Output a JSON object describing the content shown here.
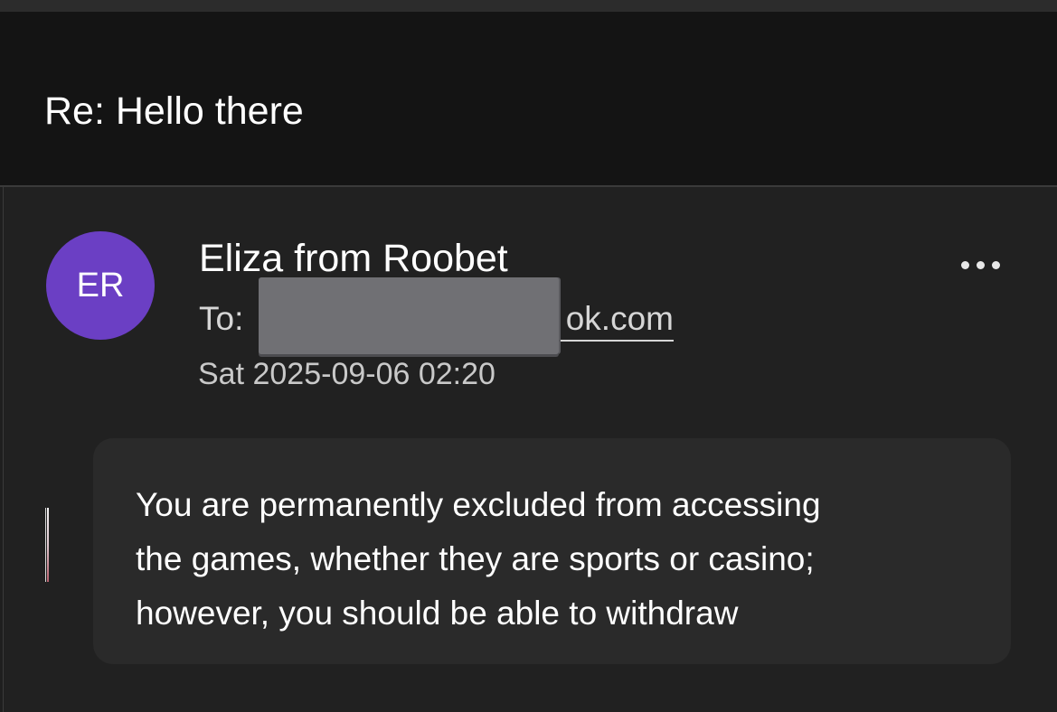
{
  "email": {
    "subject": "Re: Hello there",
    "sender": {
      "name": "Eliza from Roobet",
      "initials": "ER",
      "avatar_color": "#6b3fc4"
    },
    "to": {
      "label": "To:",
      "visible_address_fragment": "ok.com",
      "redacted": true
    },
    "date": "Sat 2025-09-06 02:20",
    "more_actions_icon": "more-horizontal-icon",
    "body_lines": [
      "You are permanently excluded from accessing",
      "the games, whether they are sports or casino;",
      "however, you should be able to withdraw"
    ]
  },
  "theme": {
    "background": "#1f1f1f",
    "header_background": "#141414",
    "card_background": "#2a2a2a",
    "text": "#ffffff",
    "muted_text": "#c9c9c9"
  }
}
